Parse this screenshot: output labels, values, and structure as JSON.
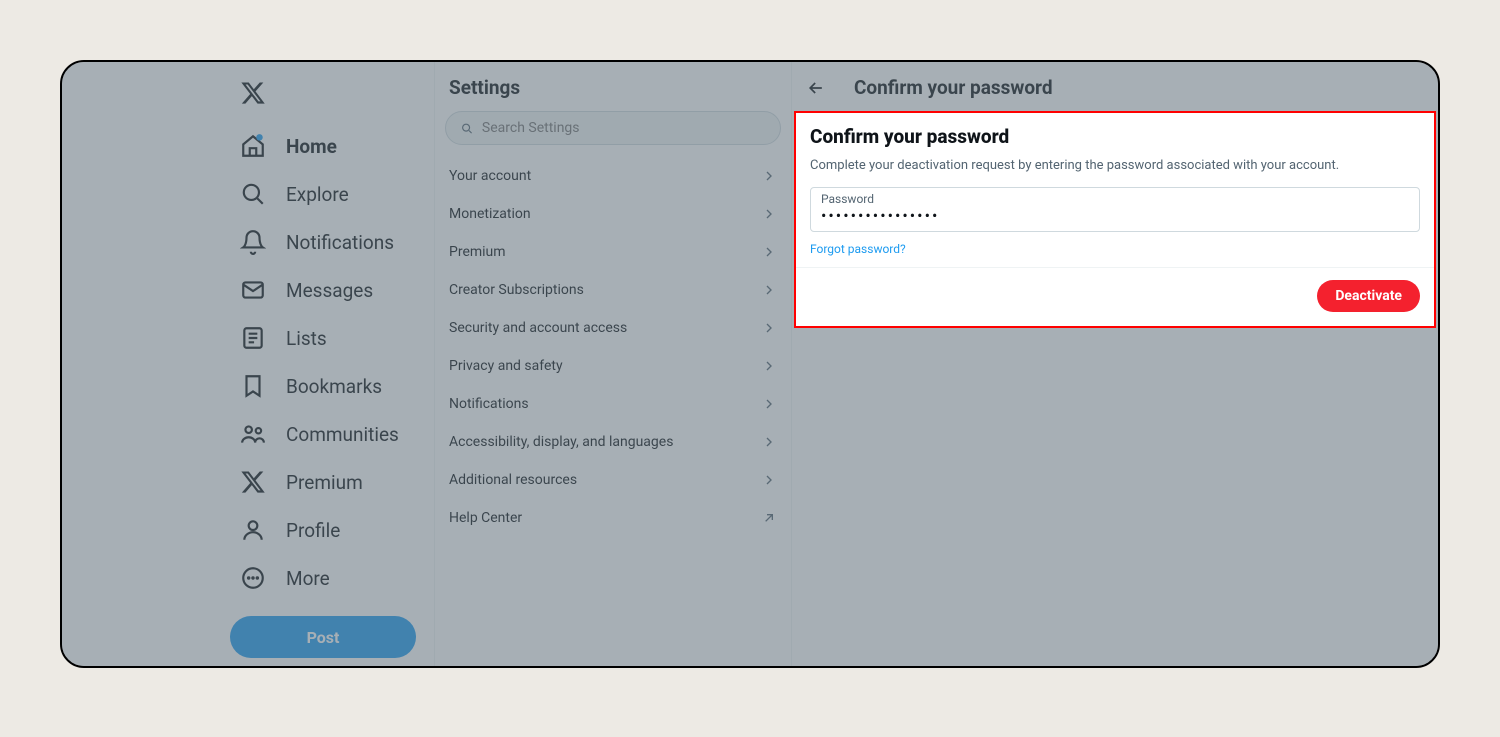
{
  "nav": {
    "items": [
      {
        "label": "Home"
      },
      {
        "label": "Explore"
      },
      {
        "label": "Notifications"
      },
      {
        "label": "Messages"
      },
      {
        "label": "Lists"
      },
      {
        "label": "Bookmarks"
      },
      {
        "label": "Communities"
      },
      {
        "label": "Premium"
      },
      {
        "label": "Profile"
      },
      {
        "label": "More"
      }
    ],
    "post_label": "Post"
  },
  "settings": {
    "title": "Settings",
    "search_placeholder": "Search Settings",
    "items": [
      {
        "label": "Your account"
      },
      {
        "label": "Monetization"
      },
      {
        "label": "Premium"
      },
      {
        "label": "Creator Subscriptions"
      },
      {
        "label": "Security and account access"
      },
      {
        "label": "Privacy and safety"
      },
      {
        "label": "Notifications"
      },
      {
        "label": "Accessibility, display, and languages"
      },
      {
        "label": "Additional resources"
      },
      {
        "label": "Help Center"
      }
    ]
  },
  "confirm": {
    "header_title": "Confirm your password",
    "panel_title": "Confirm your password",
    "subtitle": "Complete your deactivation request by entering the password associated with your account.",
    "password_label": "Password",
    "password_value": "••••••••••••••••",
    "forgot_label": "Forgot password?",
    "deactivate_label": "Deactivate"
  }
}
